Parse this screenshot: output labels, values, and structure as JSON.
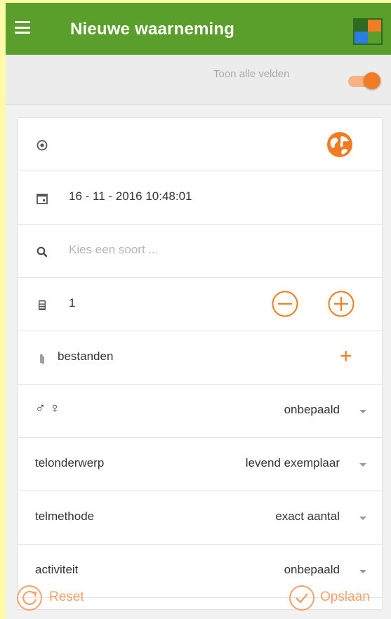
{
  "appbar": {
    "title": "Nieuwe waarneming",
    "logo_colors": [
      "#2e6b1f",
      "#f17c23",
      "#2a7de1",
      "#5a9e2b"
    ]
  },
  "toggle": {
    "label": "Toon alle velden",
    "on": true
  },
  "form": {
    "location": {
      "icon": "location-target-icon",
      "action_icon": "globe-icon"
    },
    "datetime": {
      "icon": "calendar-icon",
      "value": "16 - 11 - 2016 10:48:01"
    },
    "species": {
      "icon": "search-icon",
      "placeholder": "Kies een soort ..."
    },
    "count": {
      "icon": "calculator-icon",
      "value": "1",
      "minus_icon": "minus-circle-icon",
      "plus_icon": "plus-circle-icon"
    },
    "files": {
      "icon": "paperclip-icon",
      "label": "bestanden",
      "add_icon": "plus-icon",
      "add_symbol": "+"
    },
    "sex": {
      "symbols": "♂ ♀",
      "value": "onbepaald"
    },
    "telonderwerp": {
      "label": "telonderwerp",
      "value": "levend exemplaar"
    },
    "telmethode": {
      "label": "telmethode",
      "value": "exact aantal"
    },
    "activiteit": {
      "label": "activiteit",
      "value": "onbepaald"
    }
  },
  "actions": {
    "reset_label": "Reset",
    "save_label": "Opslaan"
  },
  "colors": {
    "accent": "#f17c23",
    "accent_light": "#f4a16a",
    "appbar": "#5a9e2b",
    "background": "#f1f1f1"
  }
}
